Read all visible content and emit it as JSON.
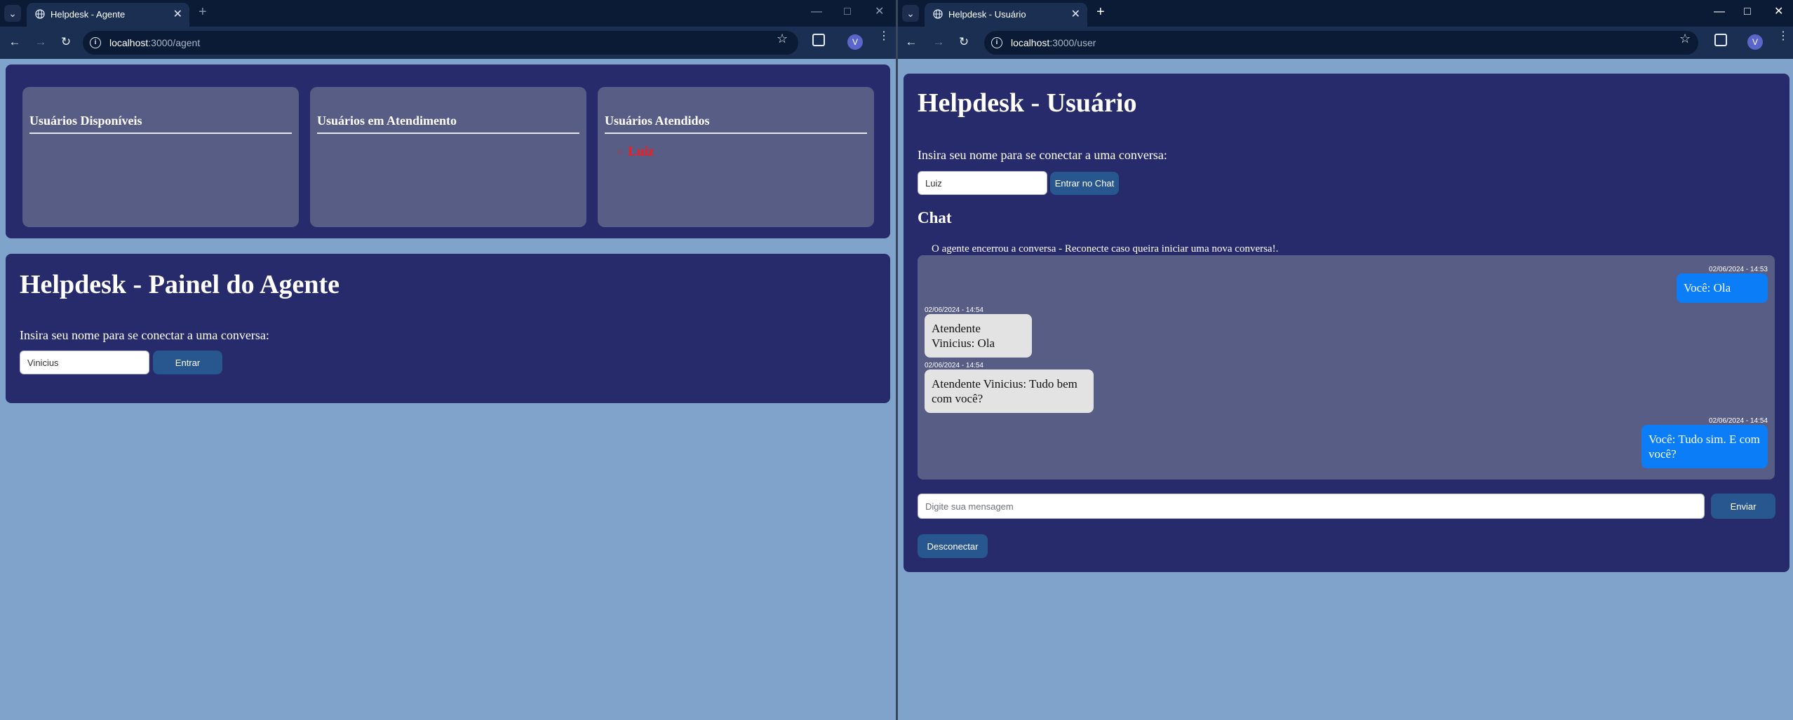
{
  "left_window": {
    "tab_title": "Helpdesk - Agente",
    "url_host": "localhost",
    "url_path": ":3000/agent",
    "profile_initial": "V",
    "cards": [
      {
        "title": "Usuários Disponíveis",
        "users": []
      },
      {
        "title": "Usuários em Atendimento",
        "users": []
      },
      {
        "title": "Usuários Atendidos",
        "users": [
          "Luiz"
        ]
      }
    ],
    "heading": "Helpdesk - Painel do Agente",
    "prompt": "Insira seu nome para se conectar a uma conversa:",
    "name_value": "Vinicius",
    "enter_button": "Entrar"
  },
  "right_window": {
    "tab_title": "Helpdesk - Usuário",
    "url_host": "localhost",
    "url_path": ":3000/user",
    "profile_initial": "V",
    "heading": "Helpdesk - Usuário",
    "prompt": "Insira seu nome para se conectar a uma conversa:",
    "name_value": "Luiz",
    "enter_chat_button": "Entrar no Chat",
    "chat_heading": "Chat",
    "notice": "O agente encerrou a conversa - Reconecte caso queira iniciar uma nova conversa!.",
    "messages": [
      {
        "from": "me",
        "timestamp": "02/06/2024 - 14:53",
        "text": "Você: Ola"
      },
      {
        "from": "them",
        "timestamp": "02/06/2024 - 14:54",
        "text": "Atendente Vinicius: Ola"
      },
      {
        "from": "them",
        "timestamp": "02/06/2024 - 14:54",
        "text": "Atendente Vinicius: Tudo bem com você?"
      },
      {
        "from": "me",
        "timestamp": "02/06/2024 - 14:54",
        "text": "Você: Tudo sim. E com você?"
      }
    ],
    "message_placeholder": "Digite sua mensagem",
    "send_button": "Enviar",
    "disconnect_button": "Desconectar"
  },
  "colors": {
    "page_bg": "#7fa3cb",
    "panel_bg": "#282b6b",
    "card_bg": "#585d86",
    "button_bg": "#28568f",
    "my_bubble": "#0a7df7",
    "their_bubble": "#e3e3e3",
    "attended_user": "#ff1818"
  }
}
